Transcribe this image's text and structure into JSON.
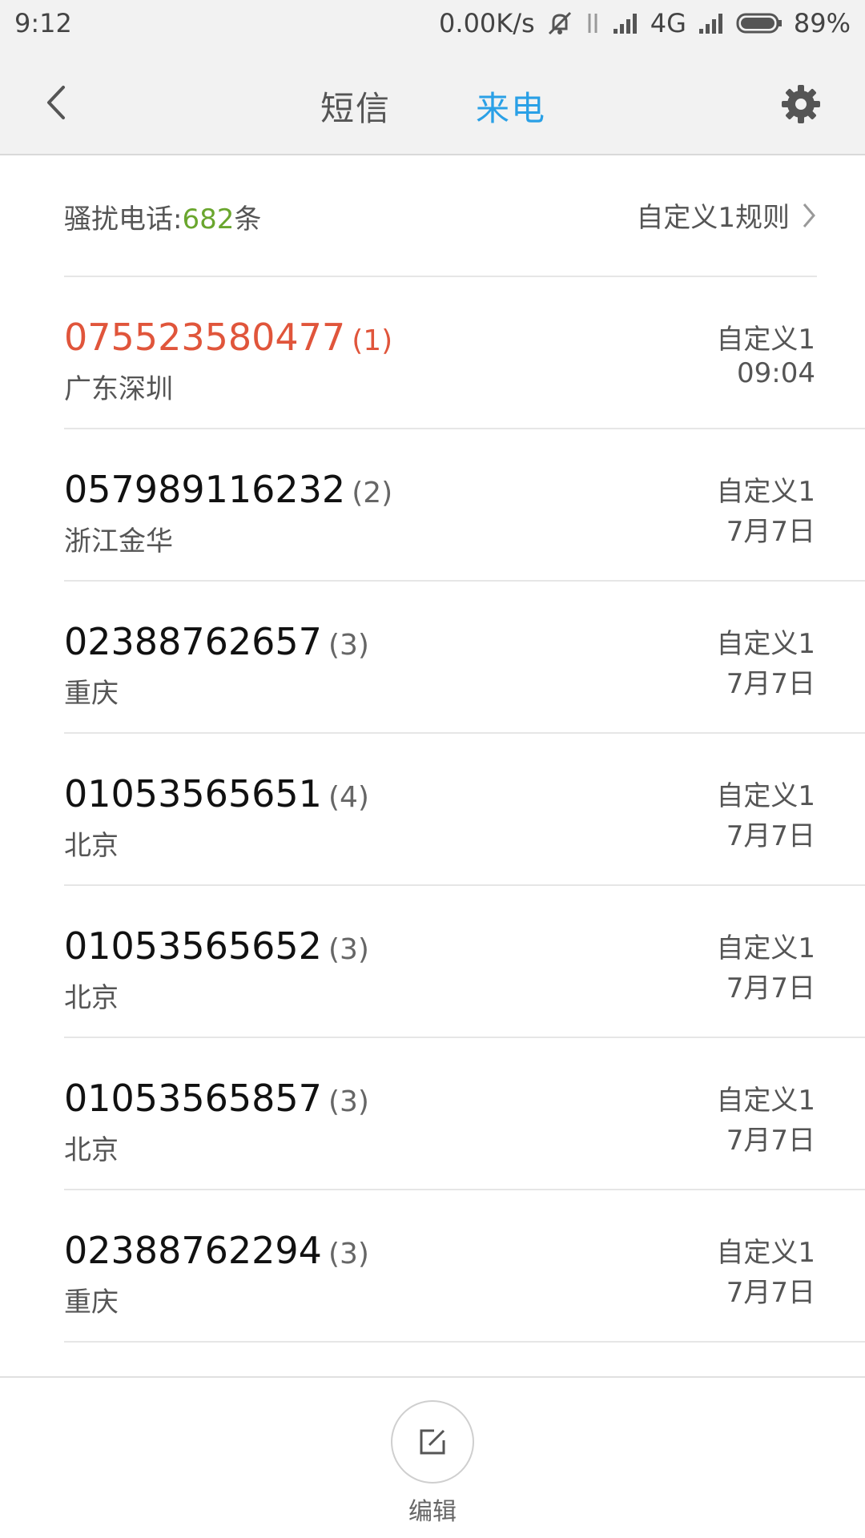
{
  "status_bar": {
    "time": "9:12",
    "speed": "0.00K/s",
    "network": "4G",
    "battery": "89%",
    "icons": [
      "mute-icon",
      "data-arrows-icon",
      "signal-icon",
      "signal-icon-2",
      "battery-icon"
    ]
  },
  "header": {
    "tabs": [
      {
        "label": "短信",
        "active": false
      },
      {
        "label": "来电",
        "active": true
      }
    ],
    "accent_color": "#2aa0e6"
  },
  "summary": {
    "label": "骚扰电话:",
    "count": "682",
    "unit": "条",
    "rules_link": "自定义1规则",
    "count_color": "#6aa62e"
  },
  "calls": [
    {
      "number": "075523580477",
      "times": "(1)",
      "location": "广东深圳",
      "rule": "自定义1",
      "date": "09:04",
      "highlight": true
    },
    {
      "number": "057989116232",
      "times": "(2)",
      "location": "浙江金华",
      "rule": "自定义1",
      "date": "7月7日"
    },
    {
      "number": "02388762657",
      "times": "(3)",
      "location": "重庆",
      "rule": "自定义1",
      "date": "7月7日"
    },
    {
      "number": "01053565651",
      "times": "(4)",
      "location": "北京",
      "rule": "自定义1",
      "date": "7月7日"
    },
    {
      "number": "01053565652",
      "times": "(3)",
      "location": "北京",
      "rule": "自定义1",
      "date": "7月7日"
    },
    {
      "number": "01053565857",
      "times": "(3)",
      "location": "北京",
      "rule": "自定义1",
      "date": "7月7日"
    },
    {
      "number": "02388762294",
      "times": "(3)",
      "location": "重庆",
      "rule": "自定义1",
      "date": "7月7日"
    }
  ],
  "bottom_bar": {
    "edit_label": "编辑",
    "edit_icon": "edit-icon"
  },
  "highlight_color": "#e0553b"
}
